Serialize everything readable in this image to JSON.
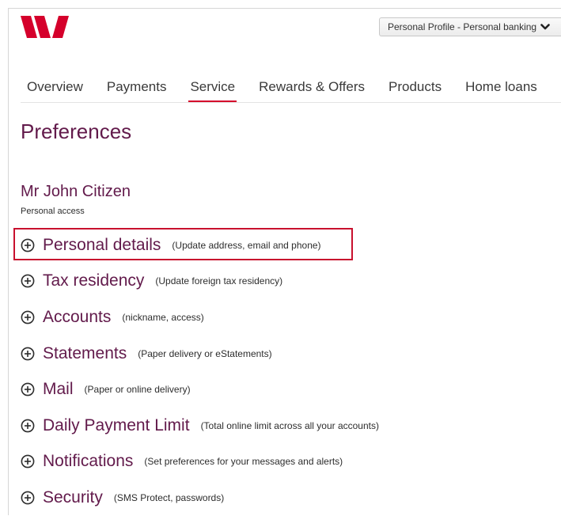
{
  "header": {
    "logo_icon": "westpac-w-logo",
    "brand_color": "#d5002b",
    "profile_selector": {
      "label": "Personal Profile - Personal banking",
      "icon": "chevron-down-icon"
    }
  },
  "nav": {
    "active_color": "#d5002b",
    "tabs": [
      {
        "label": "Overview",
        "active": false
      },
      {
        "label": "Payments",
        "active": false
      },
      {
        "label": "Service",
        "active": true
      },
      {
        "label": "Rewards & Offers",
        "active": false
      },
      {
        "label": "Products",
        "active": false
      },
      {
        "label": "Home loans",
        "active": false
      }
    ]
  },
  "page": {
    "title": "Preferences",
    "title_color": "#621a4b"
  },
  "user": {
    "name": "Mr John Citizen",
    "access": "Personal access"
  },
  "preferences": {
    "expand_icon": "circle-plus-icon",
    "highlight_color": "#c8102e",
    "items": [
      {
        "label": "Personal details",
        "hint": "(Update address, email and phone)",
        "highlighted": true
      },
      {
        "label": "Tax residency",
        "hint": "(Update foreign tax residency)",
        "highlighted": false
      },
      {
        "label": "Accounts",
        "hint": "(nickname, access)",
        "highlighted": false
      },
      {
        "label": "Statements",
        "hint": "(Paper delivery or eStatements)",
        "highlighted": false
      },
      {
        "label": "Mail",
        "hint": "(Paper or online delivery)",
        "highlighted": false
      },
      {
        "label": "Daily Payment Limit",
        "hint": "(Total online limit across all your accounts)",
        "highlighted": false
      },
      {
        "label": "Notifications",
        "hint": "(Set preferences for your messages and alerts)",
        "highlighted": false
      },
      {
        "label": "Security",
        "hint": "(SMS Protect, passwords)",
        "highlighted": false
      }
    ]
  }
}
